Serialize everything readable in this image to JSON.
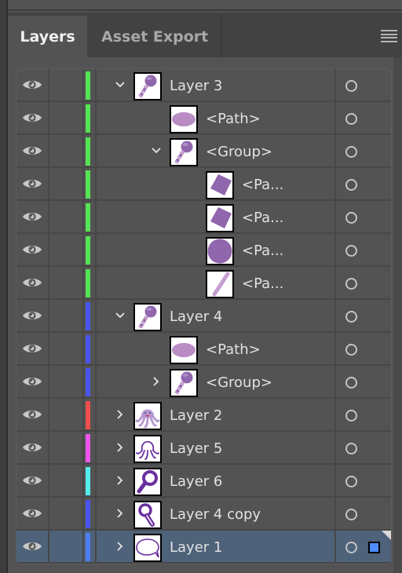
{
  "tabs": [
    {
      "label": "Layers",
      "active": true
    },
    {
      "label": "Asset Export",
      "active": false
    }
  ],
  "panel_menu_icon": "hamburger-menu-icon",
  "colors": {
    "green": "#55e455",
    "blue": "#4a55ee",
    "red": "#f04e4e",
    "magenta": "#ee55ee",
    "cyan": "#55eeee",
    "light_blue": "#4f7ef0",
    "selection_bg": "#4e6279",
    "selection_square": "#4c8cff"
  },
  "layers": [
    {
      "name": "Layer 3",
      "depth": 0,
      "color": "#55e455",
      "expand": "expanded",
      "thumb": "maraca",
      "visible": true,
      "selected": false
    },
    {
      "name": "<Path>",
      "depth": 2,
      "color": "#55e455",
      "expand": "none",
      "thumb": "ellipse",
      "visible": true,
      "selected": false
    },
    {
      "name": "<Group>",
      "depth": 1,
      "color": "#55e455",
      "expand": "expanded",
      "thumb": "maraca",
      "visible": true,
      "selected": false
    },
    {
      "name": "<Pa...",
      "depth": 3,
      "color": "#55e455",
      "expand": "none",
      "thumb": "diamond",
      "visible": true,
      "selected": false
    },
    {
      "name": "<Pa...",
      "depth": 3,
      "color": "#55e455",
      "expand": "none",
      "thumb": "diamond",
      "visible": true,
      "selected": false
    },
    {
      "name": "<Pa...",
      "depth": 3,
      "color": "#55e455",
      "expand": "none",
      "thumb": "circle",
      "visible": true,
      "selected": false
    },
    {
      "name": "<Pa...",
      "depth": 3,
      "color": "#55e455",
      "expand": "none",
      "thumb": "stick",
      "visible": true,
      "selected": false
    },
    {
      "name": "Layer 4",
      "depth": 0,
      "color": "#4a55ee",
      "expand": "expanded",
      "thumb": "maraca",
      "visible": true,
      "selected": false
    },
    {
      "name": "<Path>",
      "depth": 2,
      "color": "#4a55ee",
      "expand": "none",
      "thumb": "ellipse",
      "visible": true,
      "selected": false
    },
    {
      "name": "<Group>",
      "depth": 1,
      "color": "#4a55ee",
      "expand": "collapsed",
      "thumb": "maraca",
      "visible": true,
      "selected": false
    },
    {
      "name": "Layer 2",
      "depth": 0,
      "color": "#f04e4e",
      "expand": "collapsed",
      "thumb": "octopus",
      "visible": true,
      "selected": false
    },
    {
      "name": "Layer 5",
      "depth": 0,
      "color": "#ee55ee",
      "expand": "collapsed",
      "thumb": "octopus-outline",
      "visible": true,
      "selected": false
    },
    {
      "name": "Layer 6",
      "depth": 0,
      "color": "#55eeee",
      "expand": "collapsed",
      "thumb": "keyhole",
      "visible": true,
      "selected": false
    },
    {
      "name": "Layer 4 copy",
      "depth": 0,
      "color": "#4a55ee",
      "expand": "collapsed",
      "thumb": "keyhole-outline",
      "visible": true,
      "selected": false
    },
    {
      "name": "Layer 1",
      "depth": 0,
      "color": "#4f7ef0",
      "expand": "collapsed",
      "thumb": "speech-bubble",
      "visible": true,
      "selected": true
    }
  ]
}
